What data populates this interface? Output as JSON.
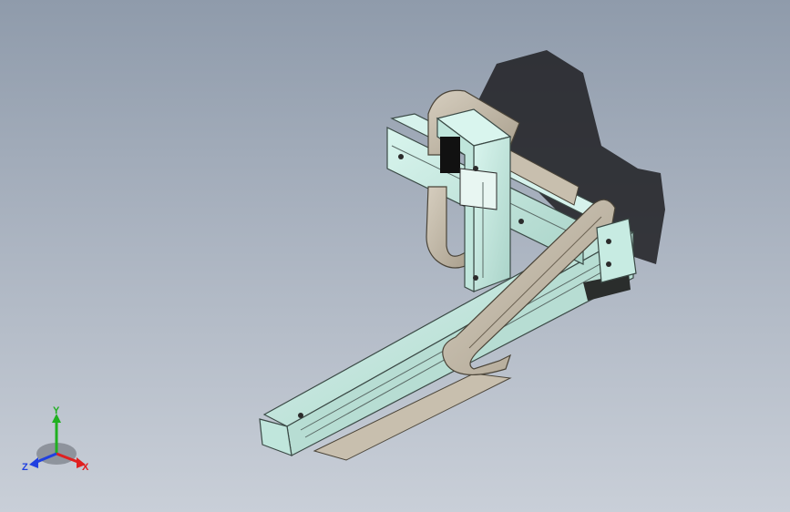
{
  "triad": {
    "x_label": "X",
    "y_label": "Y",
    "z_label": "Z",
    "x_color": "#e02020",
    "y_color": "#20b020",
    "z_color": "#2040e0"
  },
  "colors": {
    "background_top": "#8f9bab",
    "background_bottom": "#c9cfd8",
    "rail_body": "#c8ece4",
    "cable_chain": "#c8bfae",
    "shadow": "#1e1e22"
  }
}
